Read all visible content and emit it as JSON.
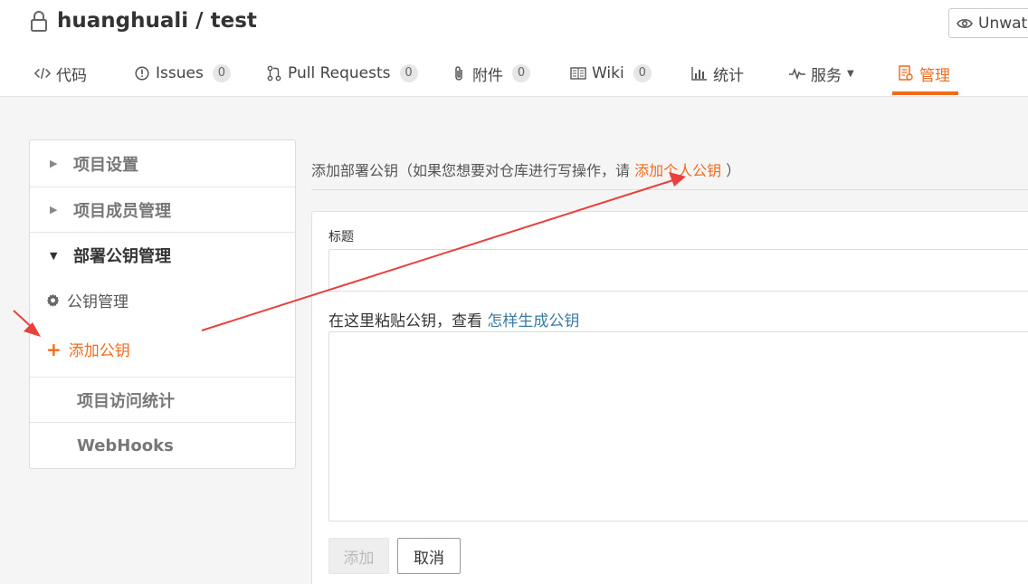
{
  "repo": {
    "owner": "huanghuali",
    "separator": "/",
    "name": "test",
    "watch_label": "Unwatch"
  },
  "nav": {
    "tabs": [
      {
        "label": "代码",
        "icon": "code-icon"
      },
      {
        "label": "Issues",
        "count": "0",
        "icon": "issue-icon"
      },
      {
        "label": "Pull Requests",
        "count": "0",
        "icon": "pull-request-icon"
      },
      {
        "label": "附件",
        "count": "0",
        "icon": "paperclip-icon"
      },
      {
        "label": "Wiki",
        "count": "0",
        "icon": "book-icon"
      },
      {
        "label": "统计",
        "icon": "bar-chart-icon"
      },
      {
        "label": "服务",
        "icon": "pulse-icon",
        "dropdown": true
      },
      {
        "label": "管理",
        "icon": "admin-icon",
        "active": true
      }
    ]
  },
  "sidebar": {
    "items": [
      {
        "label": "项目设置",
        "expanded": false
      },
      {
        "label": "项目成员管理",
        "expanded": false
      },
      {
        "label": "部署公钥管理",
        "expanded": true
      },
      {
        "label": "项目访问统计"
      },
      {
        "label": "WebHooks"
      }
    ],
    "subitems": [
      {
        "label": "公钥管理",
        "icon": "gear-icon"
      },
      {
        "label": "添加公钥",
        "icon": "plus-icon",
        "active": true
      }
    ]
  },
  "main": {
    "heading_prefix": "添加部署公钥（如果您想要对仓库进行写操作，请",
    "heading_link": "添加个人公钥",
    "heading_suffix": "）",
    "title_label": "标题",
    "title_value": "",
    "key_label": "在这里粘贴公钥，查看",
    "key_link": "怎样生成公钥",
    "key_value": "",
    "add_button": "添加",
    "cancel_button": "取消"
  },
  "colors": {
    "accent": "#f26b1d",
    "link": "#3a7ca5",
    "annotation": "#e8413c"
  }
}
